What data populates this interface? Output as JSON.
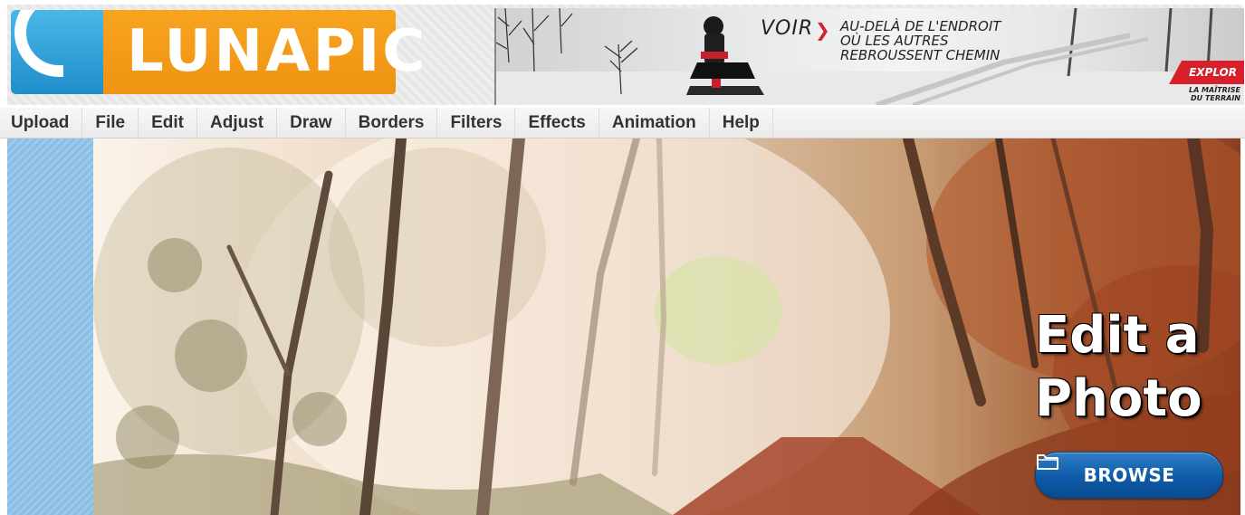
{
  "header": {
    "logo_text": "LUNAPIC"
  },
  "ad": {
    "voir": "VOIR",
    "tagline": [
      "AU-DELÀ DE L'ENDROIT",
      "OÙ LES AUTRES",
      "REBROUSSENT CHEMIN"
    ],
    "explore": "EXPLOR",
    "brand_lines": [
      "LA MAÎTRISE",
      "DU TERRAIN"
    ]
  },
  "menu": {
    "items": [
      "Upload",
      "File",
      "Edit",
      "Adjust",
      "Draw",
      "Borders",
      "Filters",
      "Effects",
      "Animation",
      "Help"
    ]
  },
  "hero": {
    "title_line1": "Edit a",
    "title_line2": "Photo",
    "browse_label": "BROWSE"
  },
  "colors": {
    "logo_blue": "#1f8ecb",
    "logo_orange": "#f39c17",
    "browse_button": "#0f5aa7",
    "side_panel": "#8abde6",
    "ad_accent": "#d8202a"
  },
  "icons": {
    "browse": "folder-icon",
    "ad_arrow": "chevron-right-icon"
  }
}
